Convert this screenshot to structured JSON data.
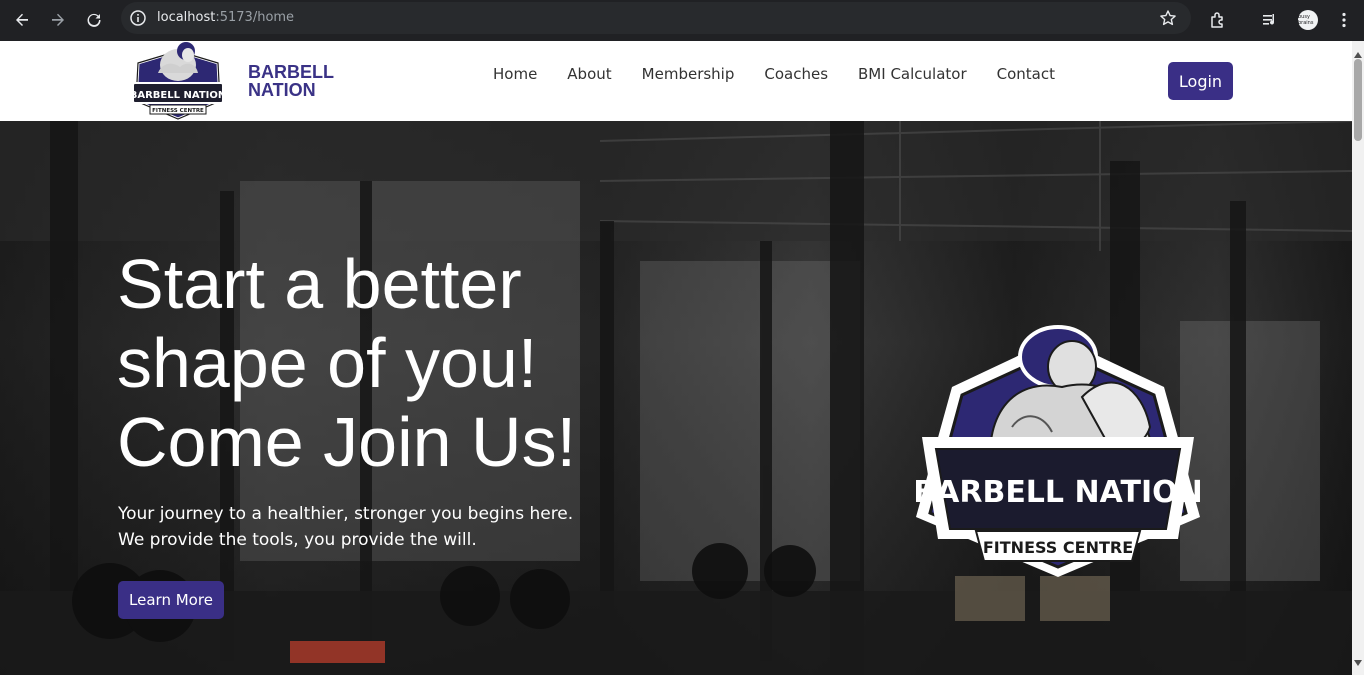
{
  "browser": {
    "url_host": "localhost",
    "url_rest": ":5173/home",
    "icons": [
      "back-icon",
      "forward-icon",
      "reload-icon",
      "site-info-icon",
      "bookmark-star-icon",
      "extensions-icon",
      "media-icon",
      "profile-avatar",
      "menu-icon"
    ],
    "avatar_text": "busy brains"
  },
  "header": {
    "brand_line1": "BARBELL",
    "brand_line2": "NATION",
    "nav": [
      "Home",
      "About",
      "Membership",
      "Coaches",
      "BMI Calculator",
      "Contact"
    ],
    "login_label": "Login"
  },
  "logo": {
    "name": "BARBELL NATION",
    "subtitle": "FITNESS CENTRE"
  },
  "hero": {
    "title_line1": "Start a better",
    "title_line2": "shape of you!",
    "title_line3": "Come Join Us!",
    "subtitle": "Your journey to a healthier, stronger you begins here. We provide the tools, you provide the will.",
    "cta_label": "Learn More"
  },
  "colors": {
    "brand": "#3a2f86",
    "chrome_bg": "#202124",
    "text_dark": "#333333"
  }
}
